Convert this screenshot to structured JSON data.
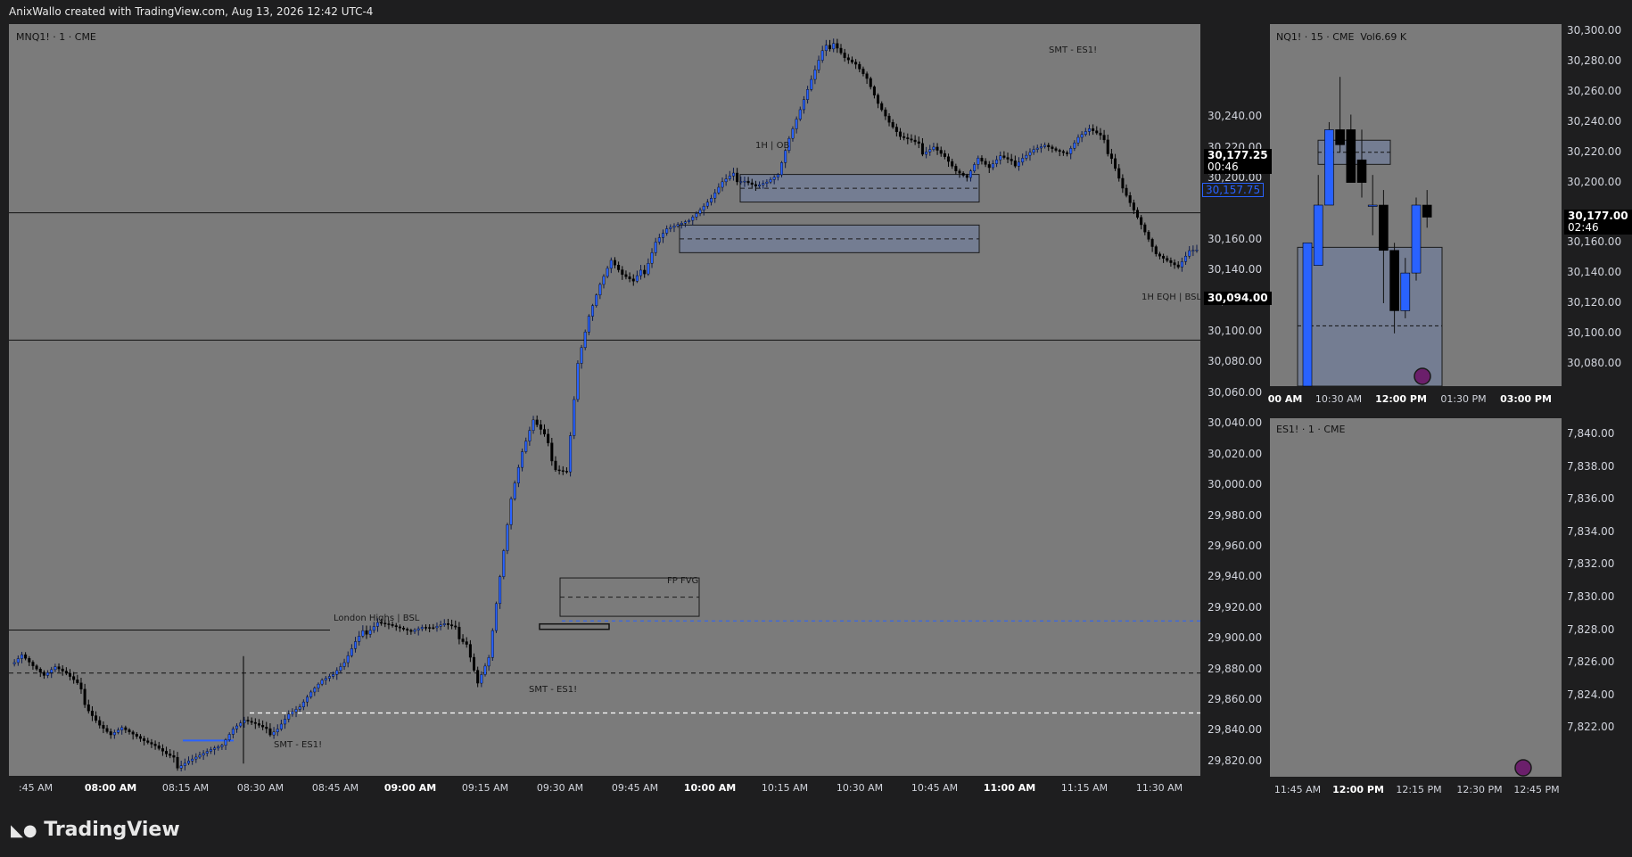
{
  "header": {
    "credit": "AnixWallo created with TradingView.com, Aug 13, 2026 12:42 UTC-4"
  },
  "brand": {
    "name": "TradingView"
  },
  "colors": {
    "panel_bg": "#7b7b7b",
    "up": "#2962ff",
    "down": "#000000",
    "zone": "#6f7fa5",
    "axis_bg": "#1e1e1f"
  },
  "chart_data": [
    {
      "type": "candlestick",
      "symbol": "MNQ1! · 1 · CME",
      "ylim": [
        29810,
        30300
      ],
      "y_ticks": [
        "30,240.00",
        "30,220.00",
        "30,200.00",
        "30,160.00",
        "30,140.00",
        "30,120.00",
        "30,100.00",
        "30,080.00",
        "30,060.00",
        "30,040.00",
        "30,020.00",
        "30,000.00",
        "29,980.00",
        "29,960.00",
        "29,940.00",
        "29,920.00",
        "29,900.00",
        "29,880.00",
        "29,860.00",
        "29,840.00",
        "29,820.00"
      ],
      "x_ticks": [
        ":45 AM",
        "08:00 AM",
        "08:15 AM",
        "08:30 AM",
        "08:45 AM",
        "09:00 AM",
        "09:15 AM",
        "09:30 AM",
        "09:45 AM",
        "10:00 AM",
        "10:15 AM",
        "10:30 AM",
        "10:45 AM",
        "11:00 AM",
        "11:15 AM",
        "11:30 AM"
      ],
      "x_ticks_bold": [
        "08:00 AM",
        "09:00 AM",
        "10:00 AM",
        "11:00 AM"
      ],
      "last_price": "30,177.25",
      "countdown": "00:46",
      "alt_price": "30,157.75",
      "level_price": "30,094.00",
      "path": [
        [
          0,
          29883
        ],
        [
          3,
          29890
        ],
        [
          6,
          29882
        ],
        [
          9,
          29875
        ],
        [
          12,
          29880
        ],
        [
          15,
          29875
        ],
        [
          18,
          29868
        ],
        [
          21,
          29855
        ],
        [
          24,
          29845
        ],
        [
          27,
          29838
        ],
        [
          30,
          29842
        ],
        [
          33,
          29837
        ],
        [
          36,
          29832
        ],
        [
          39,
          29828
        ],
        [
          42,
          29822
        ],
        [
          45,
          29818
        ],
        [
          48,
          29822
        ],
        [
          51,
          29825
        ],
        [
          54,
          29828
        ],
        [
          57,
          29830
        ],
        [
          60,
          29840
        ],
        [
          63,
          29845
        ],
        [
          66,
          29842
        ],
        [
          69,
          29838
        ],
        [
          72,
          29843
        ],
        [
          75,
          29852
        ],
        [
          78,
          29856
        ],
        [
          81,
          29865
        ],
        [
          84,
          29872
        ],
        [
          87,
          29875
        ],
        [
          90,
          29882
        ],
        [
          93,
          29895
        ],
        [
          96,
          29905
        ],
        [
          99,
          29912
        ],
        [
          102,
          29910
        ],
        [
          105,
          29907
        ],
        [
          108,
          29904
        ],
        [
          111,
          29906
        ],
        [
          114,
          29905
        ],
        [
          117,
          29907
        ],
        [
          120,
          29904
        ],
        [
          123,
          29898
        ],
        [
          126,
          29872
        ],
        [
          129,
          29888
        ],
        [
          132,
          29940
        ],
        [
          135,
          29990
        ],
        [
          138,
          30020
        ],
        [
          141,
          30040
        ],
        [
          144,
          30030
        ],
        [
          147,
          30012
        ],
        [
          150,
          30010
        ],
        [
          153,
          30080
        ],
        [
          156,
          30110
        ],
        [
          159,
          30130
        ],
        [
          162,
          30145
        ],
        [
          165,
          30135
        ],
        [
          168,
          30130
        ],
        [
          171,
          30140
        ],
        [
          174,
          30160
        ],
        [
          177,
          30168
        ],
        [
          180,
          30170
        ],
        [
          183,
          30172
        ],
        [
          186,
          30178
        ],
        [
          189,
          30185
        ],
        [
          192,
          30195
        ],
        [
          195,
          30200
        ],
        [
          198,
          30200
        ],
        [
          201,
          30196
        ],
        [
          204,
          30198
        ],
        [
          207,
          30202
        ],
        [
          210,
          30225
        ],
        [
          213,
          30243
        ],
        [
          216,
          30262
        ],
        [
          219,
          30280
        ],
        [
          222,
          30290
        ],
        [
          225,
          30280
        ],
        [
          228,
          30275
        ],
        [
          231,
          30265
        ],
        [
          234,
          30248
        ],
        [
          237,
          30235
        ],
        [
          240,
          30225
        ],
        [
          243,
          30222
        ],
        [
          246,
          30218
        ],
        [
          249,
          30222
        ],
        [
          252,
          30215
        ],
        [
          255,
          30205
        ],
        [
          258,
          30200
        ],
        [
          261,
          30212
        ],
        [
          264,
          30205
        ],
        [
          267,
          30212
        ],
        [
          270,
          30208
        ],
        [
          273,
          30215
        ],
        [
          276,
          30220
        ],
        [
          279,
          30222
        ],
        [
          282,
          30218
        ],
        [
          285,
          30215
        ],
        [
          288,
          30225
        ],
        [
          291,
          30230
        ],
        [
          294,
          30225
        ],
        [
          297,
          30215
        ],
        [
          300,
          30195
        ],
        [
          303,
          30180
        ],
        [
          306,
          30165
        ],
        [
          309,
          30150
        ],
        [
          312,
          30145
        ],
        [
          315,
          30140
        ],
        [
          318,
          30150
        ],
        [
          320,
          30150
        ]
      ],
      "annotations": [
        "London Highs | BSL",
        "SMT - ES1!",
        "SMT - ES1!",
        "SMT - ES1!",
        "FP FVG",
        "1H | OB",
        "1H EQH | BSL"
      ]
    },
    {
      "type": "candlestick",
      "symbol": "NQ1! · 15 · CME",
      "volume_label": "Vol",
      "volume": "6.69 K",
      "ylim": [
        30065,
        30305
      ],
      "y_ticks": [
        "30,300.00",
        "30,280.00",
        "30,260.00",
        "30,240.00",
        "30,220.00",
        "30,200.00",
        "30,160.00",
        "30,140.00",
        "30,120.00",
        "30,100.00",
        "30,080.00"
      ],
      "x_ticks": [
        "00 AM",
        "10:30 AM",
        "12:00 PM",
        "01:30 PM",
        "03:00 PM"
      ],
      "x_ticks_bold": [
        "00 AM",
        "12:00 PM",
        "03:00 PM"
      ],
      "last_price": "30,177.00",
      "countdown": "02:46",
      "candles": [
        {
          "o": 30065,
          "h": 30160,
          "l": 30065,
          "c": 30160
        },
        {
          "o": 30145,
          "h": 30205,
          "l": 30145,
          "c": 30185
        },
        {
          "o": 30185,
          "h": 30240,
          "l": 30185,
          "c": 30235
        },
        {
          "o": 30235,
          "h": 30270,
          "l": 30220,
          "c": 30225
        },
        {
          "o": 30235,
          "h": 30245,
          "l": 30200,
          "c": 30200
        },
        {
          "o": 30215,
          "h": 30235,
          "l": 30190,
          "c": 30200
        },
        {
          "o": 30185,
          "h": 30205,
          "l": 30165,
          "c": 30185
        },
        {
          "o": 30185,
          "h": 30195,
          "l": 30120,
          "c": 30155
        },
        {
          "o": 30155,
          "h": 30160,
          "l": 30100,
          "c": 30115
        },
        {
          "o": 30115,
          "h": 30150,
          "l": 30110,
          "c": 30140
        },
        {
          "o": 30140,
          "h": 30190,
          "l": 30135,
          "c": 30185
        },
        {
          "o": 30185,
          "h": 30195,
          "l": 30170,
          "c": 30177
        }
      ]
    },
    {
      "type": "candlestick",
      "symbol": "ES1! · 1 · CME",
      "ylim": [
        7819,
        7841
      ],
      "y_ticks": [
        "7,840.00",
        "7,838.00",
        "7,836.00",
        "7,834.00",
        "7,832.00",
        "7,830.00",
        "7,828.00",
        "7,826.00",
        "7,824.00",
        "7,822.00"
      ],
      "x_ticks": [
        "11:45 AM",
        "12:00 PM",
        "12:15 PM",
        "12:30 PM",
        "12:45 PM"
      ],
      "x_ticks_bold": [
        "12:00 PM"
      ]
    }
  ]
}
